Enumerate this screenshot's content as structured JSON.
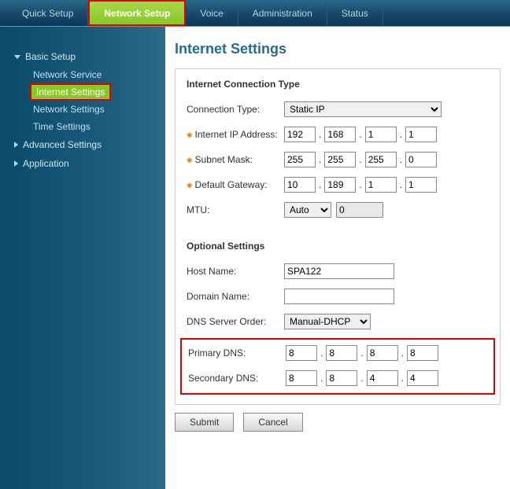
{
  "top_nav": {
    "items": [
      {
        "label": "Quick Setup"
      },
      {
        "label": "Network Setup"
      },
      {
        "label": "Voice"
      },
      {
        "label": "Administration"
      },
      {
        "label": "Status"
      }
    ]
  },
  "sidebar": {
    "basic_setup": {
      "label": "Basic Setup",
      "children": [
        {
          "label": "Network Service"
        },
        {
          "label": "Internet Settings"
        },
        {
          "label": "Network Settings"
        },
        {
          "label": "Time Settings"
        }
      ]
    },
    "advanced_settings": {
      "label": "Advanced Settings"
    },
    "application": {
      "label": "Application"
    }
  },
  "page": {
    "title": "Internet Settings",
    "section_connection": "Internet Connection Type",
    "section_optional": "Optional Settings",
    "labels": {
      "connection_type": "Connection Type:",
      "internet_ip": "Internet IP Address:",
      "subnet_mask": "Subnet Mask:",
      "default_gateway": "Default Gateway:",
      "mtu": "MTU:",
      "host_name": "Host Name:",
      "domain_name": "Domain Name:",
      "dns_server_order": "DNS Server Order:",
      "primary_dns": "Primary DNS:",
      "secondary_dns": "Secondary DNS:"
    },
    "values": {
      "connection_type": "Static IP",
      "internet_ip": [
        "192",
        "168",
        "1",
        "1"
      ],
      "subnet_mask": [
        "255",
        "255",
        "255",
        "0"
      ],
      "default_gateway": [
        "10",
        "189",
        "1",
        "1"
      ],
      "mtu_mode": "Auto",
      "mtu_value": "0",
      "host_name": "SPA122",
      "domain_name": "",
      "dns_server_order": "Manual-DHCP",
      "primary_dns": [
        "8",
        "8",
        "8",
        "8"
      ],
      "secondary_dns": [
        "8",
        "8",
        "4",
        "4"
      ]
    },
    "buttons": {
      "submit": "Submit",
      "cancel": "Cancel"
    }
  }
}
